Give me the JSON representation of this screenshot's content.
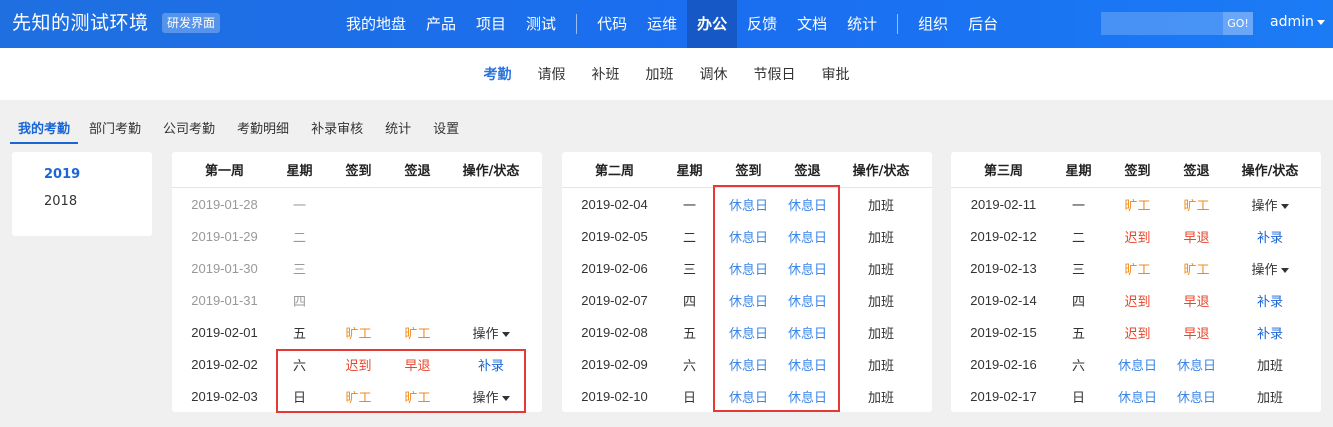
{
  "app": {
    "title": "先知的测试环境",
    "badge": "研发界面"
  },
  "main_nav": {
    "group1": [
      "我的地盘",
      "产品",
      "项目",
      "测试"
    ],
    "group2": [
      "代码",
      "运维",
      "办公",
      "反馈",
      "文档",
      "统计"
    ],
    "group3": [
      "组织",
      "后台"
    ],
    "active": "办公"
  },
  "search": {
    "value": "",
    "placeholder": "",
    "go_label": "GO!"
  },
  "user": {
    "name": "admin"
  },
  "sub_nav": {
    "items": [
      "考勤",
      "请假",
      "补班",
      "加班",
      "调休",
      "节假日",
      "审批"
    ],
    "active": "考勤"
  },
  "tabs": {
    "items": [
      "我的考勤",
      "部门考勤",
      "公司考勤",
      "考勤明细",
      "补录审核",
      "统计",
      "设置"
    ],
    "active": "我的考勤"
  },
  "years": {
    "items": [
      "2019",
      "2018"
    ],
    "active": "2019"
  },
  "weeks": [
    {
      "headers": [
        "第一周",
        "星期",
        "签到",
        "签退",
        "操作/状态"
      ],
      "rows": [
        {
          "date": "2019-01-28",
          "weekday": "一",
          "signin": "",
          "signout": "",
          "action": "",
          "dim": true
        },
        {
          "date": "2019-01-29",
          "weekday": "二",
          "signin": "",
          "signout": "",
          "action": "",
          "dim": true
        },
        {
          "date": "2019-01-30",
          "weekday": "三",
          "signin": "",
          "signout": "",
          "action": "",
          "dim": true
        },
        {
          "date": "2019-01-31",
          "weekday": "四",
          "signin": "",
          "signout": "",
          "action": "",
          "dim": true
        },
        {
          "date": "2019-02-01",
          "weekday": "五",
          "signin": "旷工",
          "signout": "旷工",
          "action": "操作"
        },
        {
          "date": "2019-02-02",
          "weekday": "六",
          "signin": "迟到",
          "signout": "早退",
          "action": "补录"
        },
        {
          "date": "2019-02-03",
          "weekday": "日",
          "signin": "旷工",
          "signout": "旷工",
          "action": "操作"
        }
      ]
    },
    {
      "headers": [
        "第二周",
        "星期",
        "签到",
        "签退",
        "操作/状态"
      ],
      "rows": [
        {
          "date": "2019-02-04",
          "weekday": "一",
          "signin": "休息日",
          "signout": "休息日",
          "action": "加班"
        },
        {
          "date": "2019-02-05",
          "weekday": "二",
          "signin": "休息日",
          "signout": "休息日",
          "action": "加班"
        },
        {
          "date": "2019-02-06",
          "weekday": "三",
          "signin": "休息日",
          "signout": "休息日",
          "action": "加班"
        },
        {
          "date": "2019-02-07",
          "weekday": "四",
          "signin": "休息日",
          "signout": "休息日",
          "action": "加班"
        },
        {
          "date": "2019-02-08",
          "weekday": "五",
          "signin": "休息日",
          "signout": "休息日",
          "action": "加班"
        },
        {
          "date": "2019-02-09",
          "weekday": "六",
          "signin": "休息日",
          "signout": "休息日",
          "action": "加班"
        },
        {
          "date": "2019-02-10",
          "weekday": "日",
          "signin": "休息日",
          "signout": "休息日",
          "action": "加班"
        }
      ]
    },
    {
      "headers": [
        "第三周",
        "星期",
        "签到",
        "签退",
        "操作/状态"
      ],
      "rows": [
        {
          "date": "2019-02-11",
          "weekday": "一",
          "signin": "旷工",
          "signout": "旷工",
          "action": "操作"
        },
        {
          "date": "2019-02-12",
          "weekday": "二",
          "signin": "迟到",
          "signout": "早退",
          "action": "补录"
        },
        {
          "date": "2019-02-13",
          "weekday": "三",
          "signin": "旷工",
          "signout": "旷工",
          "action": "操作"
        },
        {
          "date": "2019-02-14",
          "weekday": "四",
          "signin": "迟到",
          "signout": "早退",
          "action": "补录"
        },
        {
          "date": "2019-02-15",
          "weekday": "五",
          "signin": "迟到",
          "signout": "早退",
          "action": "补录"
        },
        {
          "date": "2019-02-16",
          "weekday": "六",
          "signin": "休息日",
          "signout": "休息日",
          "action": "加班"
        },
        {
          "date": "2019-02-17",
          "weekday": "日",
          "signin": "休息日",
          "signout": "休息日",
          "action": "加班"
        }
      ]
    }
  ],
  "colors": {
    "nav_bg": "#1a6ef0",
    "active_blue": "#1a66d6",
    "absent": "#f08b1e",
    "late": "#e8452c",
    "rest": "#3b86e8",
    "highlight": "#e53935"
  }
}
